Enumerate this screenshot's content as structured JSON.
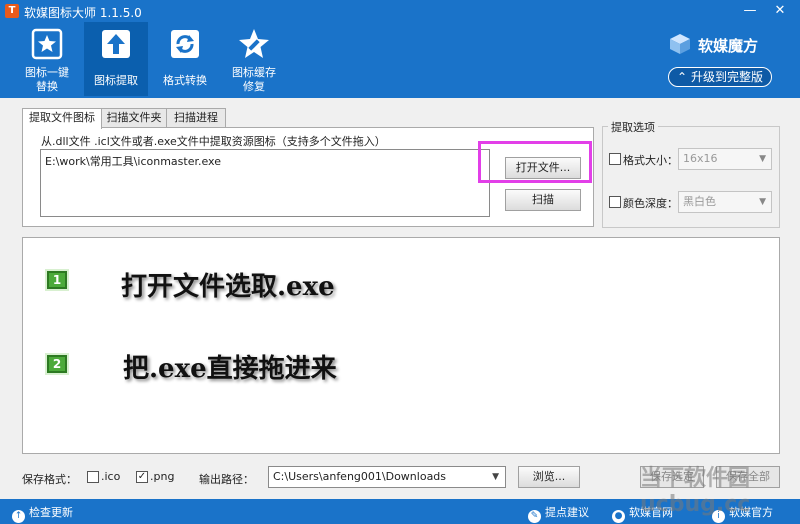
{
  "window": {
    "title": "软媒图标大师 1.1.5.0"
  },
  "toolbar": {
    "items": [
      {
        "label_1": "图标一键",
        "label_2": "替换",
        "icon": "star-icon"
      },
      {
        "label_1": "图标提取",
        "label_2": "",
        "icon": "upload-icon"
      },
      {
        "label_1": "格式转换",
        "label_2": "",
        "icon": "refresh-icon"
      },
      {
        "label_1": "图标缓存",
        "label_2": "修复",
        "icon": "wrench-star-icon"
      }
    ],
    "brand": "软媒魔方",
    "upgrade": "升级到完整版"
  },
  "tabs": [
    "提取文件图标",
    "扫描文件夹",
    "扫描进程"
  ],
  "extract": {
    "description": "从.dll文件 .icl文件或者.exe文件中提取资源图标（支持多个文件拖入）",
    "path": "E:\\work\\常用工具\\iconmaster.exe",
    "open_button": "打开文件...",
    "scan_button": "扫描"
  },
  "options": {
    "title": "提取选项",
    "size_label": "格式大小：",
    "size_value": "16x16",
    "depth_label": "颜色深度：",
    "depth_value": "黑白色"
  },
  "instructions": [
    {
      "num": "1",
      "text": "打开文件选取.exe"
    },
    {
      "num": "2",
      "text": "把.exe直接拖进来"
    }
  ],
  "bottom": {
    "format_label": "保存格式：",
    "ico_label": ".ico",
    "png_label": ".png",
    "png_check": "✓",
    "output_label": "输出路径：",
    "output_path": "C:\\Users\\anfeng001\\Downloads",
    "browse": "浏览...",
    "save_selected": "保存选定",
    "save_all": "保存全部"
  },
  "status": {
    "check_update": "检查更新",
    "suggest": "提点建议",
    "item3": "软媒官网",
    "item4": "软媒官方"
  },
  "watermark": "当下软件园 ucbug.cc"
}
